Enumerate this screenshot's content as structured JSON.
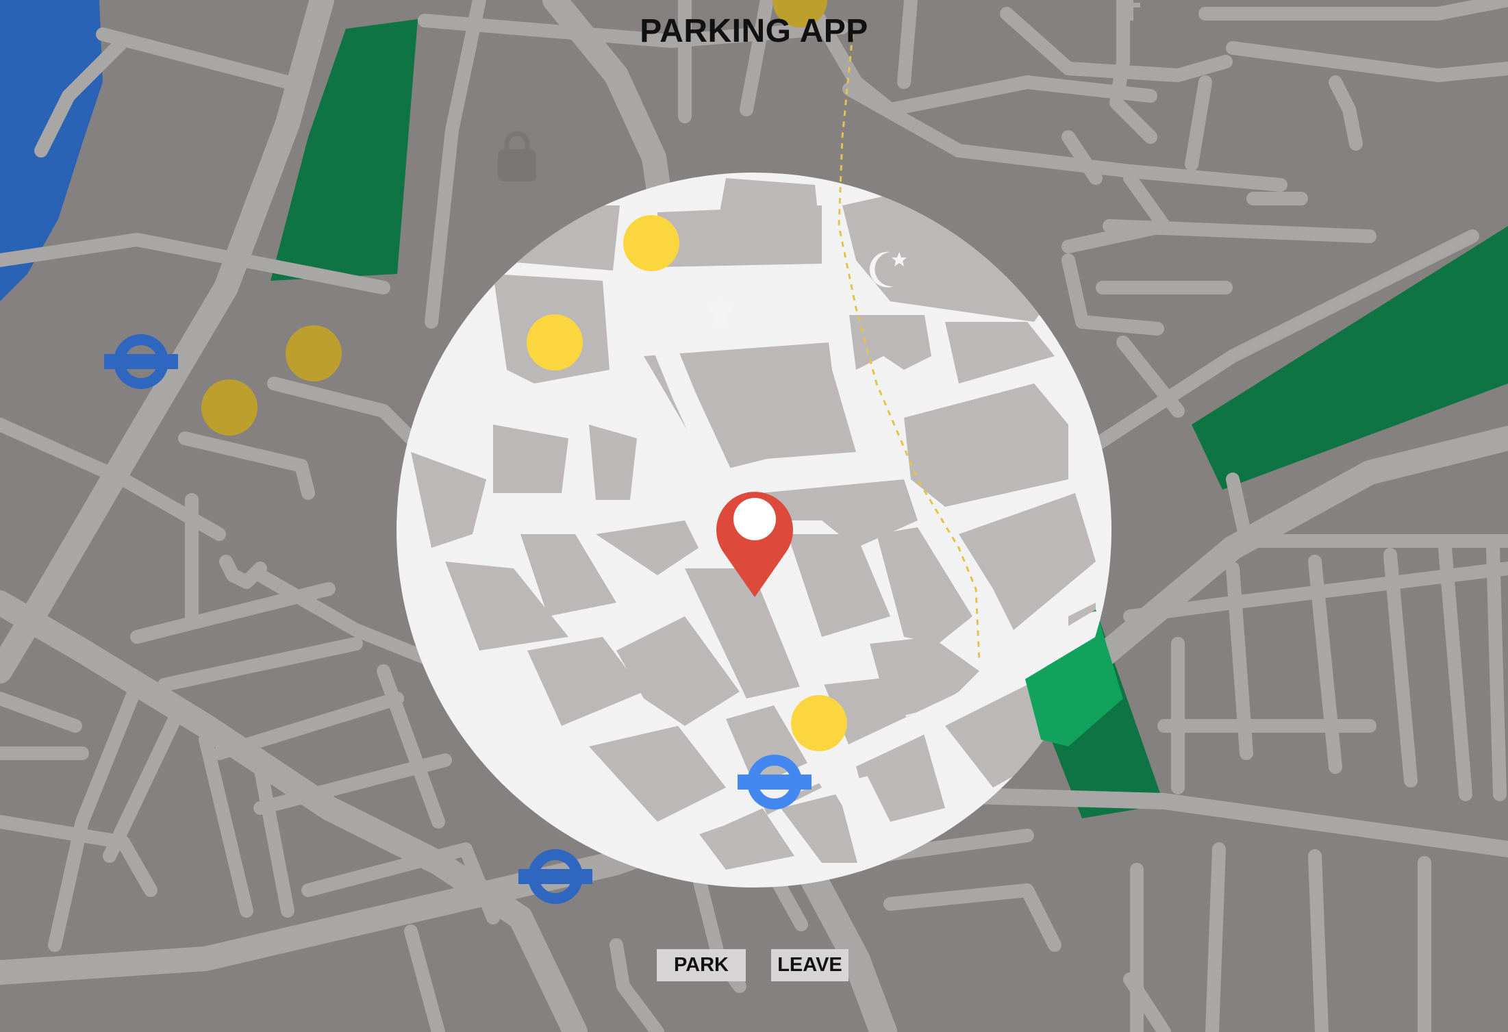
{
  "app": {
    "title": "PARKING APP"
  },
  "controls": {
    "park_label": "PARK",
    "leave_label": "LEAVE"
  },
  "map": {
    "icons": {
      "location_marker": "map-pin-icon",
      "parking_spot": "parking-spot-icon",
      "transit_station": "underground-station-icon",
      "church": "cross-icon",
      "mosque": "crescent-star-icon",
      "shopping": "shopping-bag-icon"
    },
    "colors": {
      "land": "#858181",
      "road": "#a9a6a6",
      "highlight_area": "#f3f2f2",
      "water": "#2a62b5",
      "park": "#0e7443",
      "park_light": "#11a35c",
      "parking_spot": "#fcd63e",
      "parking_spot_dim": "#bd9f2e",
      "marker": "#dd4a3b",
      "transit_active": "#4288f0",
      "transit": "#2f66c0"
    }
  }
}
